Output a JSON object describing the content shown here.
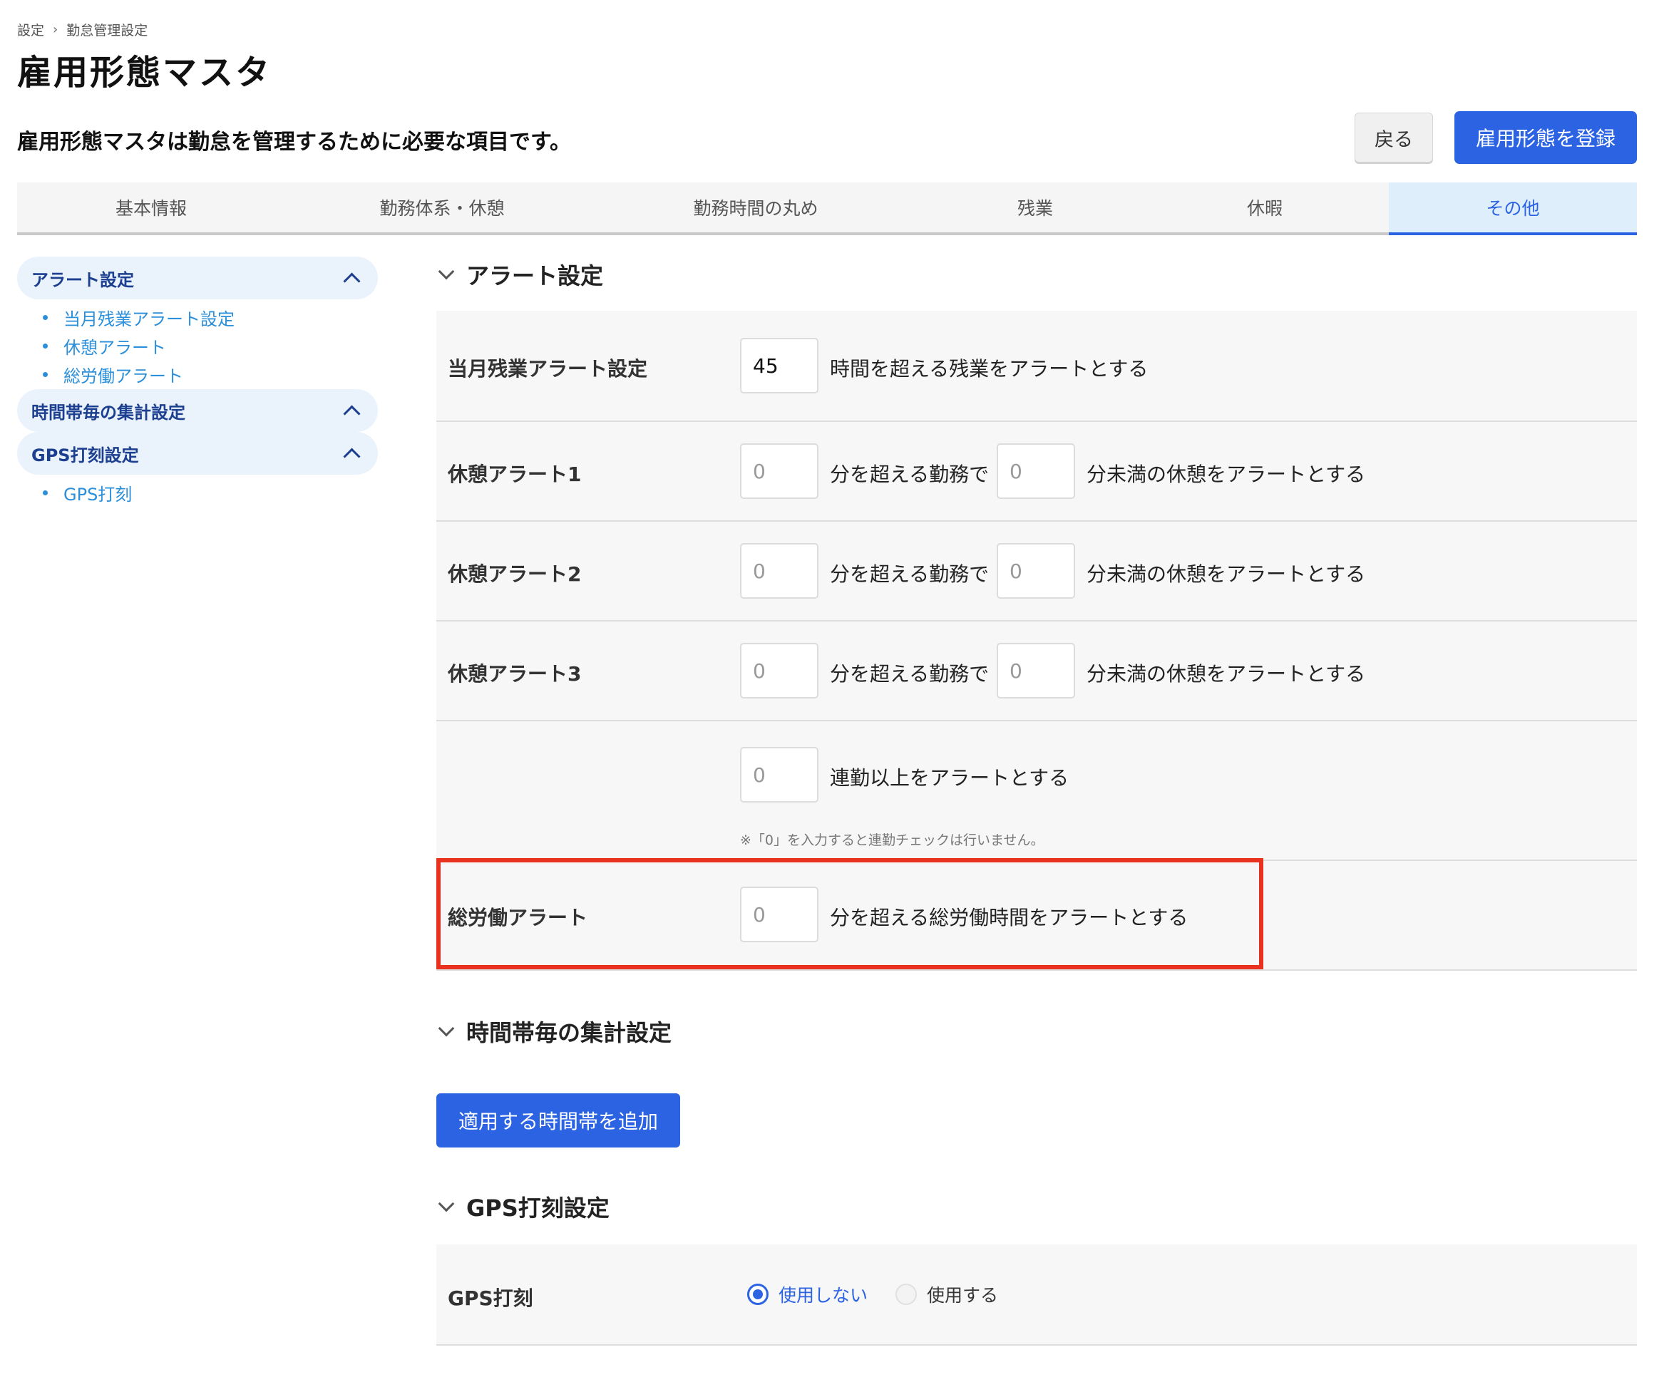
{
  "breadcrumb": {
    "items": [
      "設定",
      "勤怠管理設定"
    ],
    "separator": "›"
  },
  "page": {
    "title": "雇用形態マスタ",
    "description": "雇用形態マスタは勤怠を管理するために必要な項目です。"
  },
  "buttons": {
    "back": "戻る",
    "register": "雇用形態を登録",
    "add_time_range": "適用する時間帯を追加"
  },
  "tabs": [
    "基本情報",
    "勤務体系・休憩",
    "勤務時間の丸め",
    "残業",
    "休暇",
    "その他"
  ],
  "active_tab": "その他",
  "sidebar": {
    "groups": [
      {
        "label": "アラート設定",
        "items": [
          "当月残業アラート設定",
          "休憩アラート",
          "総労働アラート"
        ]
      },
      {
        "label": "時間帯毎の集計設定",
        "items": []
      },
      {
        "label": "GPS打刻設定",
        "items": [
          "GPS打刻"
        ]
      }
    ]
  },
  "alert_section": {
    "title": "アラート設定",
    "overtime": {
      "label": "当月残業アラート設定",
      "value": "45",
      "suffix": "時間を超える残業をアラートとする"
    },
    "breaks": [
      {
        "label": "休憩アラート1",
        "work_value": "0",
        "mid_text": "分を超える勤務で",
        "break_value": "0",
        "suffix": "分未満の休憩をアラートとする"
      },
      {
        "label": "休憩アラート2",
        "work_value": "0",
        "mid_text": "分を超える勤務で",
        "break_value": "0",
        "suffix": "分未満の休憩をアラートとする"
      },
      {
        "label": "休憩アラート3",
        "work_value": "0",
        "mid_text": "分を超える勤務で",
        "break_value": "0",
        "suffix": "分未満の休憩をアラートとする"
      }
    ],
    "consecutive": {
      "value": "0",
      "suffix": "連勤以上をアラートとする",
      "note": "※「0」を入力すると連勤チェックは行いません。"
    },
    "total": {
      "label": "総労働アラート",
      "value": "0",
      "suffix": "分を超える総労働時間をアラートとする"
    }
  },
  "time_section": {
    "title": "時間帯毎の集計設定"
  },
  "gps_section": {
    "title": "GPS打刻設定",
    "label": "GPS打刻",
    "options": [
      "使用しない",
      "使用する"
    ],
    "selected": "使用しない"
  },
  "colors": {
    "accent": "#2b63e3",
    "highlight": "#e8311f",
    "link": "#2b8fd9"
  }
}
